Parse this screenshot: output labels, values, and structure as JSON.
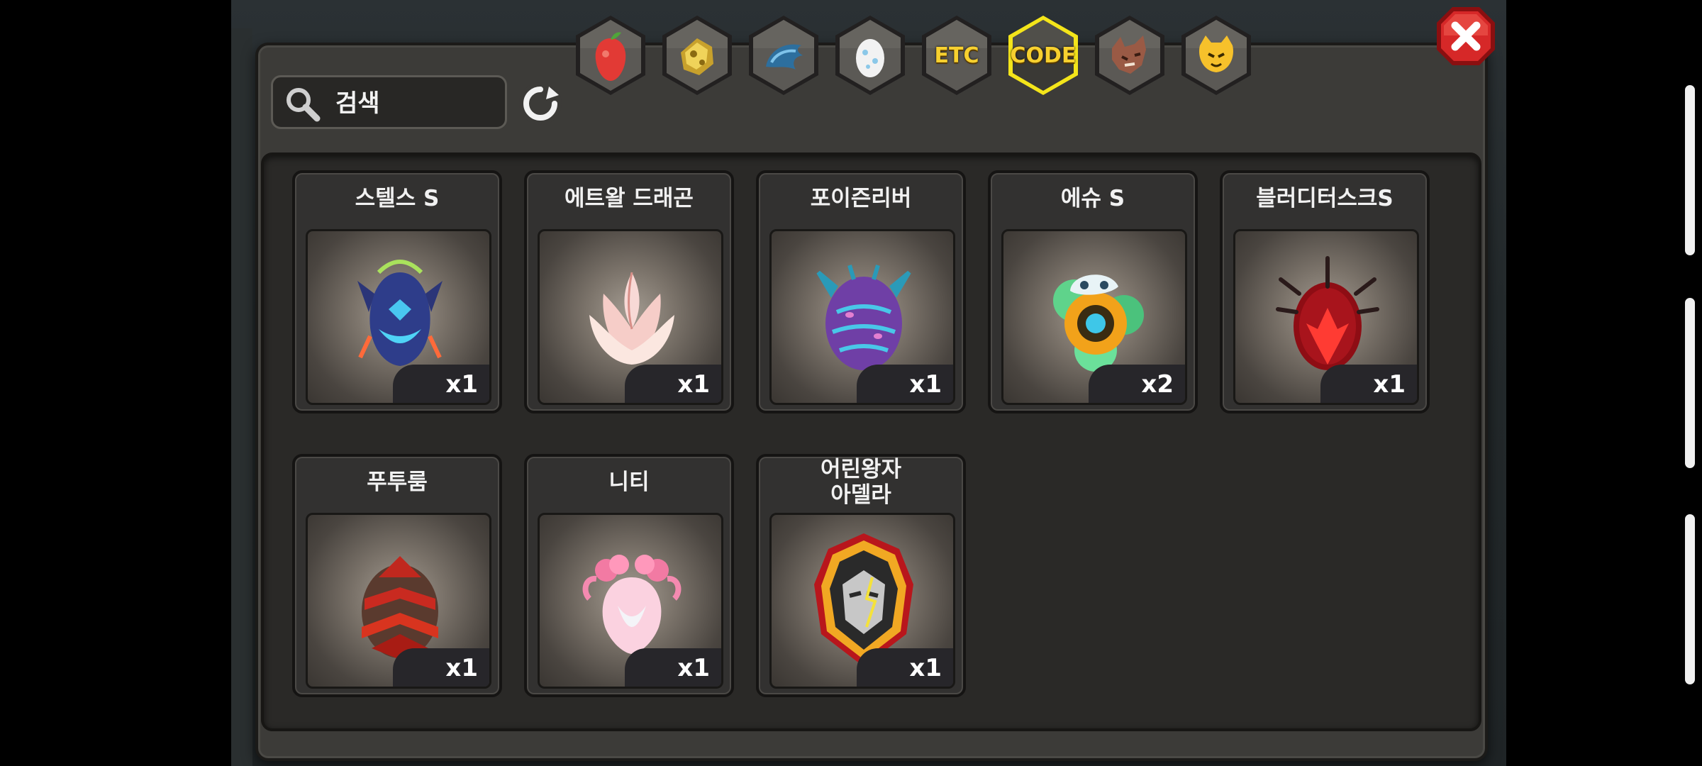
{
  "search": {
    "label": "검색"
  },
  "tabs": [
    {
      "name": "tab-fruit",
      "icon": "fruit-icon",
      "label": ""
    },
    {
      "name": "tab-ore",
      "icon": "ore-icon",
      "label": ""
    },
    {
      "name": "tab-scale",
      "icon": "scale-icon",
      "label": ""
    },
    {
      "name": "tab-egg",
      "icon": "egg-icon",
      "label": ""
    },
    {
      "name": "tab-etc",
      "icon": "",
      "label": "ETC"
    },
    {
      "name": "tab-code",
      "icon": "",
      "label": "CODE",
      "selected": true
    },
    {
      "name": "tab-beast",
      "icon": "wolf-icon",
      "label": ""
    },
    {
      "name": "tab-mascot",
      "icon": "cat-face-icon",
      "label": ""
    }
  ],
  "items": [
    {
      "name": "스텔스 S",
      "qty": "x1",
      "icon": "stealth-egg-icon"
    },
    {
      "name": "에트왈 드래곤",
      "qty": "x1",
      "icon": "lotus-egg-icon"
    },
    {
      "name": "포이즌리버",
      "qty": "x1",
      "icon": "poison-egg-icon"
    },
    {
      "name": "에슈 S",
      "qty": "x2",
      "icon": "esu-egg-icon"
    },
    {
      "name": "블러디터스크S",
      "qty": "x1",
      "icon": "bloody-egg-icon"
    },
    {
      "name": "푸투룸",
      "qty": "x1",
      "icon": "armored-egg-icon"
    },
    {
      "name": "니티",
      "qty": "x1",
      "icon": "pink-egg-icon"
    },
    {
      "name": "어린왕자\n아델라",
      "qty": "x1",
      "icon": "golden-emblem-icon"
    }
  ],
  "colors": {
    "accent": "#f7d02f",
    "close": "#d62828",
    "panel": "#3c3b38"
  }
}
